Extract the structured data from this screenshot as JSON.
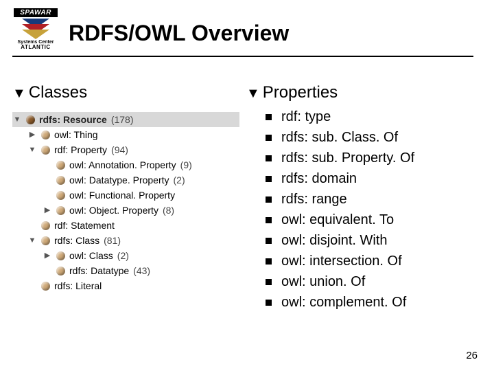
{
  "logo": {
    "word": "SPAWAR",
    "sub1": "Systems Center",
    "sub2": "ATLANTIC"
  },
  "title": "RDFS/OWL Overview",
  "left": {
    "heading": "Classes",
    "tree": [
      {
        "depth": 0,
        "disclosure": "down",
        "dot": "br",
        "label": "rdfs: Resource",
        "count": "(178)",
        "bold": true,
        "selected": true
      },
      {
        "depth": 1,
        "disclosure": "right",
        "dot": "lb",
        "label": "owl: Thing",
        "count": "",
        "bold": false,
        "selected": false
      },
      {
        "depth": 1,
        "disclosure": "down",
        "dot": "lb",
        "label": "rdf: Property",
        "count": "(94)",
        "bold": false,
        "selected": false
      },
      {
        "depth": 2,
        "disclosure": "none",
        "dot": "lb",
        "label": "owl: Annotation. Property",
        "count": "(9)",
        "bold": false,
        "selected": false
      },
      {
        "depth": 2,
        "disclosure": "none",
        "dot": "lb",
        "label": "owl: Datatype. Property",
        "count": "(2)",
        "bold": false,
        "selected": false
      },
      {
        "depth": 2,
        "disclosure": "none",
        "dot": "lb",
        "label": "owl: Functional. Property",
        "count": "",
        "bold": false,
        "selected": false
      },
      {
        "depth": 2,
        "disclosure": "right",
        "dot": "lb",
        "label": "owl: Object. Property",
        "count": "(8)",
        "bold": false,
        "selected": false
      },
      {
        "depth": 1,
        "disclosure": "none",
        "dot": "lb",
        "label": "rdf: Statement",
        "count": "",
        "bold": false,
        "selected": false
      },
      {
        "depth": 1,
        "disclosure": "down",
        "dot": "lb",
        "label": "rdfs: Class",
        "count": "(81)",
        "bold": false,
        "selected": false
      },
      {
        "depth": 2,
        "disclosure": "right",
        "dot": "lb",
        "label": "owl: Class",
        "count": "(2)",
        "bold": false,
        "selected": false
      },
      {
        "depth": 2,
        "disclosure": "none",
        "dot": "lb",
        "label": "rdfs: Datatype",
        "count": "(43)",
        "bold": false,
        "selected": false
      },
      {
        "depth": 1,
        "disclosure": "none",
        "dot": "lb",
        "label": "rdfs: Literal",
        "count": "",
        "bold": false,
        "selected": false
      }
    ]
  },
  "right": {
    "heading": "Properties",
    "items": [
      "rdf: type",
      "rdfs: sub. Class. Of",
      "rdfs: sub. Property. Of",
      "rdfs: domain",
      "rdfs: range",
      "owl: equivalent. To",
      "owl: disjoint. With",
      "owl: intersection. Of",
      "owl: union. Of",
      "owl: complement. Of"
    ]
  },
  "page_number": "26"
}
